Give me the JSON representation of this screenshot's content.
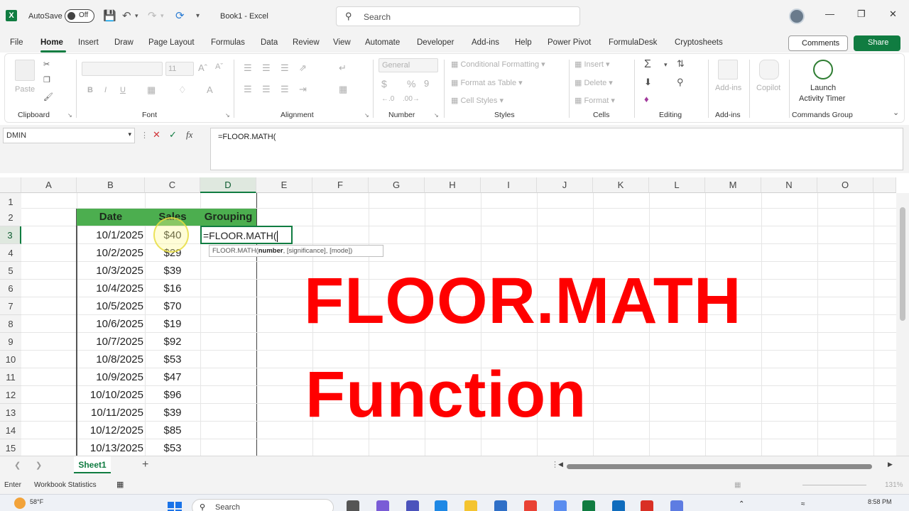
{
  "titlebar": {
    "autosave_label": "AutoSave",
    "autosave_state": "Off",
    "doc_title": "Book1 - Excel",
    "search_placeholder": "Search",
    "app_icon": "excel-icon"
  },
  "menu": {
    "items": [
      "File",
      "Home",
      "Insert",
      "Draw",
      "Page Layout",
      "Formulas",
      "Data",
      "Review",
      "View",
      "Automate",
      "Developer",
      "Add-ins",
      "Help",
      "Power Pivot",
      "FormulaDesk",
      "Cryptosheets"
    ],
    "active": "Home",
    "comments_label": "Comments",
    "share_label": "Share"
  },
  "ribbon": {
    "groups": [
      "Clipboard",
      "Font",
      "Alignment",
      "Number",
      "Styles",
      "Cells",
      "Editing",
      "Add-ins",
      "Commands Group"
    ],
    "paste_label": "Paste",
    "font_size": "11",
    "number_format": "General",
    "conditional_formatting": "Conditional Formatting",
    "format_as_table": "Format as Table",
    "cell_styles": "Cell Styles",
    "insert_label": "Insert",
    "delete_label": "Delete",
    "format_label": "Format",
    "addins_label": "Add-ins",
    "copilot_label": "Copilot",
    "launch_line1": "Launch",
    "launch_line2": "Activity Timer"
  },
  "formula_bar": {
    "name_box": "DMIN",
    "formula": "=FLOOR.MATH("
  },
  "grid": {
    "columns": [
      "A",
      "B",
      "C",
      "D",
      "E",
      "F",
      "G",
      "H",
      "I",
      "J",
      "K",
      "L",
      "M",
      "N",
      "O"
    ],
    "rows": [
      "1",
      "2",
      "3",
      "4",
      "5",
      "6",
      "7",
      "8",
      "9",
      "10",
      "11",
      "12",
      "13",
      "14",
      "15"
    ],
    "table_headers": [
      "Date",
      "Sales",
      "Grouping"
    ],
    "table_rows": [
      {
        "date": "10/1/2025",
        "sales": "$40",
        "grouping": "=FLOOR.MATH("
      },
      {
        "date": "10/2/2025",
        "sales": "$29",
        "grouping": ""
      },
      {
        "date": "10/3/2025",
        "sales": "$39",
        "grouping": ""
      },
      {
        "date": "10/4/2025",
        "sales": "$16",
        "grouping": ""
      },
      {
        "date": "10/5/2025",
        "sales": "$70",
        "grouping": ""
      },
      {
        "date": "10/6/2025",
        "sales": "$19",
        "grouping": ""
      },
      {
        "date": "10/7/2025",
        "sales": "$92",
        "grouping": ""
      },
      {
        "date": "10/8/2025",
        "sales": "$53",
        "grouping": ""
      },
      {
        "date": "10/9/2025",
        "sales": "$47",
        "grouping": ""
      },
      {
        "date": "10/10/2025",
        "sales": "$96",
        "grouping": ""
      },
      {
        "date": "10/11/2025",
        "sales": "$39",
        "grouping": ""
      },
      {
        "date": "10/12/2025",
        "sales": "$85",
        "grouping": ""
      },
      {
        "date": "10/13/2025",
        "sales": "$53",
        "grouping": ""
      }
    ],
    "tooltip_fn": "FLOOR.MATH(",
    "tooltip_arg": "number",
    "tooltip_rest": ", [significance], [mode])",
    "overlay_line1": "FLOOR.MATH",
    "overlay_line2": "Function",
    "header_color": "#4cae4f",
    "overlay_color": "#ff0000"
  },
  "sheets": {
    "tabs": [
      "Sheet1"
    ],
    "add_label": "+"
  },
  "status": {
    "mode": "Enter",
    "workbook_statistics": "Workbook Statistics",
    "zoom": "131%"
  },
  "taskbar": {
    "weather": "58°F",
    "search_label": "Search",
    "time": "8:58 PM"
  }
}
